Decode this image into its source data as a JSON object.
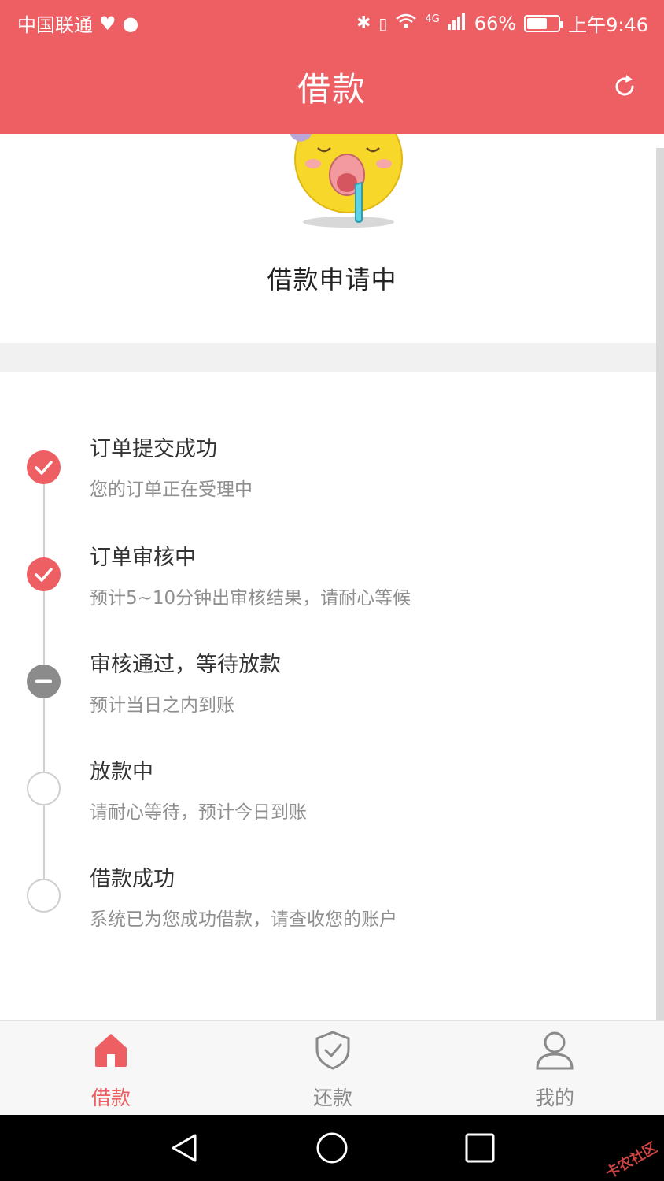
{
  "status_bar": {
    "carrier": "中国联通",
    "network": "4G",
    "battery": "66%",
    "battery_level": 0.66,
    "time": "上午9:46"
  },
  "header": {
    "title": "借款",
    "refresh_icon": "refresh-icon"
  },
  "hero": {
    "status_title": "借款申请中",
    "mascot_icon": "sleeping-emoji-icon"
  },
  "steps": [
    {
      "title": "订单提交成功",
      "desc": "您的订单正在受理中",
      "state": "done"
    },
    {
      "title": "订单审核中",
      "desc": "预计5~10分钟出审核结果，请耐心等候",
      "state": "done"
    },
    {
      "title": "审核通过，等待放款",
      "desc": "预计当日之内到账",
      "state": "current"
    },
    {
      "title": "放款中",
      "desc": "请耐心等待，预计今日到账",
      "state": "pending"
    },
    {
      "title": "借款成功",
      "desc": "系统已为您成功借款，请查收您的账户",
      "state": "pending"
    }
  ],
  "tabs": [
    {
      "label": "借款",
      "icon": "home-icon",
      "active": true
    },
    {
      "label": "还款",
      "icon": "shield-check-icon",
      "active": false
    },
    {
      "label": "我的",
      "icon": "user-icon",
      "active": false
    }
  ],
  "colors": {
    "accent": "#ee5f64",
    "muted": "#8f8f8f",
    "current_node": "#8b8b8b"
  },
  "watermark": "卡农社区"
}
